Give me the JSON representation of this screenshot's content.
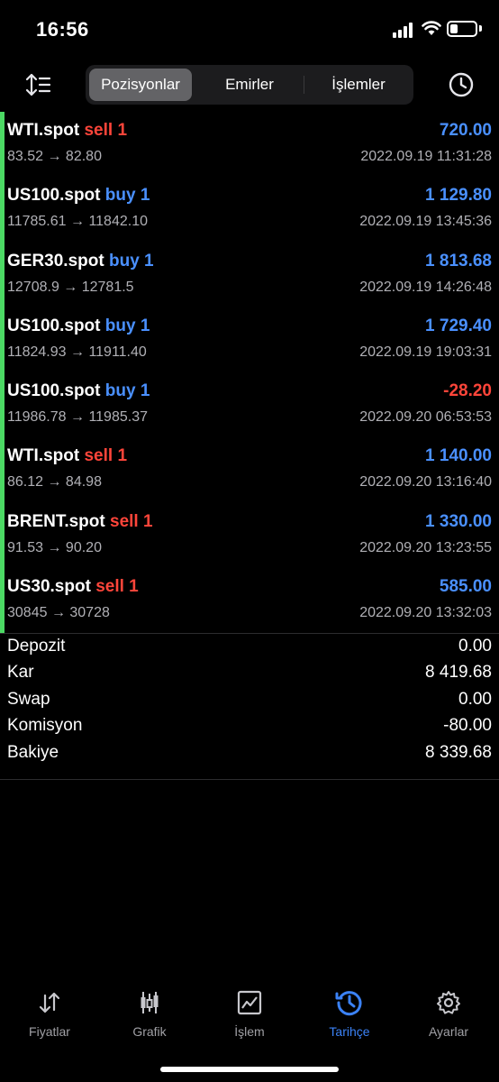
{
  "status_bar": {
    "time": "16:56"
  },
  "segments": [
    {
      "label": "Pozisyonlar",
      "active": true
    },
    {
      "label": "Emirler",
      "active": false
    },
    {
      "label": "İşlemler",
      "active": false
    }
  ],
  "trades": [
    {
      "symbol": "WTI.spot",
      "side": "sell 1",
      "side_type": "sell",
      "profit": "720.00",
      "profit_sign": "pos",
      "prices": "83.52 → 82.80",
      "time": "2022.09.19 11:31:28"
    },
    {
      "symbol": "US100.spot",
      "side": "buy 1",
      "side_type": "buy",
      "profit": "1 129.80",
      "profit_sign": "pos",
      "prices": "11785.61 → 11842.10",
      "time": "2022.09.19 13:45:36"
    },
    {
      "symbol": "GER30.spot",
      "side": "buy 1",
      "side_type": "buy",
      "profit": "1 813.68",
      "profit_sign": "pos",
      "prices": "12708.9 → 12781.5",
      "time": "2022.09.19 14:26:48"
    },
    {
      "symbol": "US100.spot",
      "side": "buy 1",
      "side_type": "buy",
      "profit": "1 729.40",
      "profit_sign": "pos",
      "prices": "11824.93 → 11911.40",
      "time": "2022.09.19 19:03:31"
    },
    {
      "symbol": "US100.spot",
      "side": "buy 1",
      "side_type": "buy",
      "profit": "-28.20",
      "profit_sign": "neg",
      "prices": "11986.78 → 11985.37",
      "time": "2022.09.20 06:53:53"
    },
    {
      "symbol": "WTI.spot",
      "side": "sell 1",
      "side_type": "sell",
      "profit": "1 140.00",
      "profit_sign": "pos",
      "prices": "86.12 → 84.98",
      "time": "2022.09.20 13:16:40"
    },
    {
      "symbol": "BRENT.spot",
      "side": "sell 1",
      "side_type": "sell",
      "profit": "1 330.00",
      "profit_sign": "pos",
      "prices": "91.53 → 90.20",
      "time": "2022.09.20 13:23:55"
    },
    {
      "symbol": "US30.spot",
      "side": "sell 1",
      "side_type": "sell",
      "profit": "585.00",
      "profit_sign": "pos",
      "prices": "30845 → 30728",
      "time": "2022.09.20 13:32:03"
    }
  ],
  "summary": [
    {
      "label": "Depozit",
      "value": "0.00"
    },
    {
      "label": "Kar",
      "value": "8 419.68"
    },
    {
      "label": "Swap",
      "value": "0.00"
    },
    {
      "label": "Komisyon",
      "value": "-80.00"
    },
    {
      "label": "Bakiye",
      "value": "8 339.68"
    }
  ],
  "tabs": [
    {
      "label": "Fiyatlar",
      "icon": "quotes-arrows-icon",
      "active": false
    },
    {
      "label": "Grafik",
      "icon": "candlestick-chart-icon",
      "active": false
    },
    {
      "label": "İşlem",
      "icon": "trade-line-chart-icon",
      "active": false
    },
    {
      "label": "Tarihçe",
      "icon": "history-clock-icon",
      "active": true
    },
    {
      "label": "Ayarlar",
      "icon": "gear-icon",
      "active": false
    }
  ],
  "colors": {
    "profit_positive": "#4a90ff",
    "profit_negative": "#ff453a",
    "sell": "#ff453a",
    "buy": "#4a90ff",
    "row_marker": "#4cd964",
    "tab_active": "#3b82f6"
  }
}
